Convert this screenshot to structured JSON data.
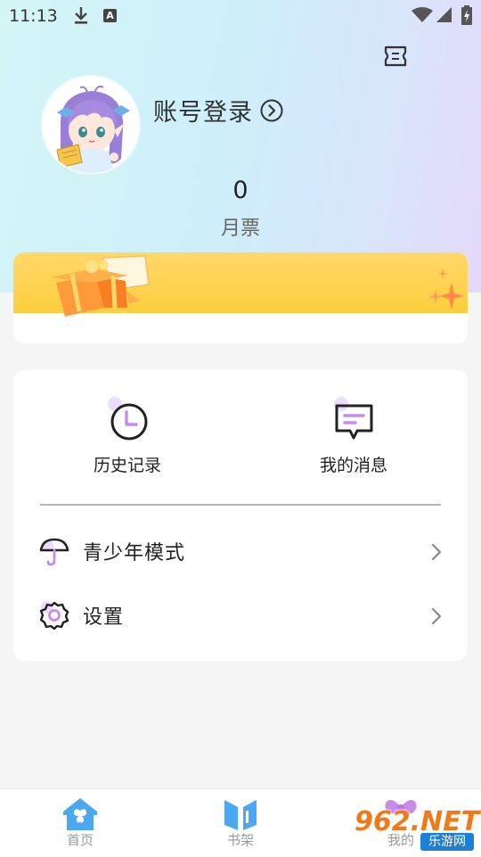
{
  "status_bar": {
    "time": "11:13",
    "indicator_letter": "A"
  },
  "profile": {
    "login_label": "账号登录",
    "ticket_count": "0",
    "ticket_label": "月票"
  },
  "quick_actions": [
    {
      "label": "历史记录",
      "icon": "clock-icon"
    },
    {
      "label": "我的消息",
      "icon": "message-icon"
    }
  ],
  "menu_rows": [
    {
      "label": "青少年模式",
      "icon": "umbrella-icon"
    },
    {
      "label": "设置",
      "icon": "gear-icon"
    }
  ],
  "tabs": [
    {
      "label": "首页",
      "icon": "home-icon",
      "active": true
    },
    {
      "label": "书架",
      "icon": "bookshelf-icon",
      "active": false
    },
    {
      "label": "我的",
      "icon": "bow-icon",
      "active": false
    }
  ],
  "watermark": {
    "main": "962.NET",
    "sub": "乐游网"
  },
  "colors": {
    "accent_purple": "#c98be8",
    "tab_blue": "#4aa7f0",
    "banner_yellow": "#ffd34a"
  }
}
